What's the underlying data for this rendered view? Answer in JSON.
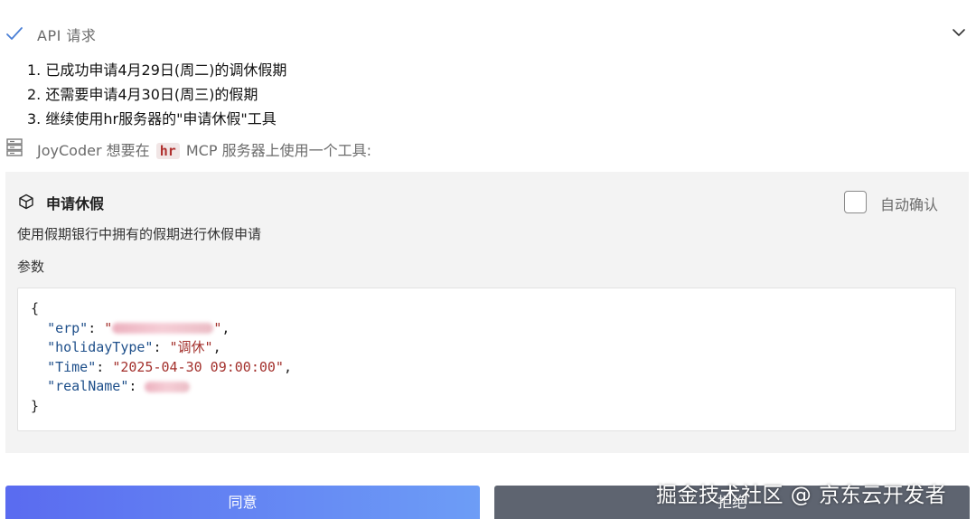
{
  "api_section": {
    "title": "API 请求",
    "icons": {
      "status": "check-icon",
      "toggle": "chevron-down-icon"
    }
  },
  "steps": [
    "1. 已成功申请4月29日(周二)的调休假期",
    "2. 还需要申请4月30日(周三)的假期",
    "3. 继续使用hr服务器的\"申请休假\"工具"
  ],
  "mcp_request": {
    "icon": "server-icon",
    "prefix": "JoyCoder 想要在",
    "server": "hr",
    "suffix": "MCP 服务器上使用一个工具:"
  },
  "tool": {
    "icon": "cube-icon",
    "name": "申请休假",
    "description": "使用假期银行中拥有的假期进行休假申请",
    "auto_confirm_label": "自动确认",
    "auto_confirm_checked": false,
    "params_label": "参数",
    "params": {
      "open": "{",
      "close": "}",
      "erp_key": "\"erp\"",
      "holiday_key": "\"holidayType\"",
      "holiday_value": "\"调休\"",
      "time_key": "\"Time\"",
      "time_value": "\"2025-04-30 09:00:00\"",
      "realname_key": "\"realName\""
    }
  },
  "actions": {
    "approve_label": "同意",
    "reject_label": "拒绝"
  },
  "watermark": "掘金技术社区 @ 京东云开发者",
  "colors": {
    "accent_gradient_start": "#5a6bf0",
    "accent_gradient_end": "#6d9df6",
    "reject_bg": "#5e6470",
    "string_color": "#a3302c",
    "key_color": "#1e4f8a"
  }
}
